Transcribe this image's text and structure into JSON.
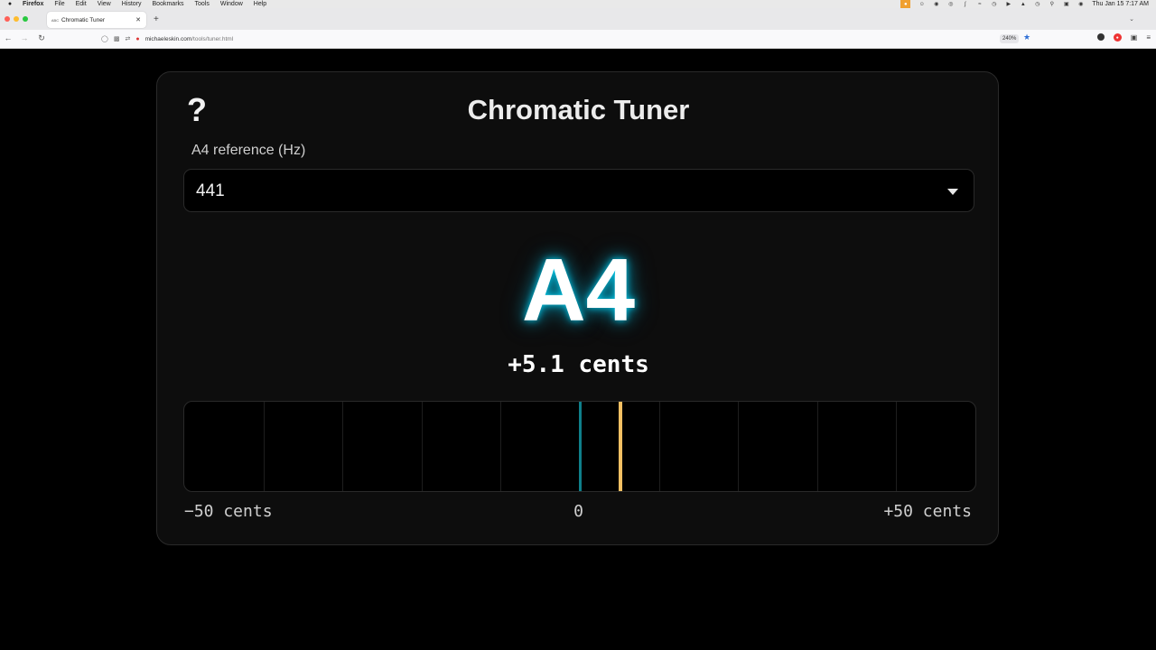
{
  "menubar": {
    "items": [
      "Firefox",
      "File",
      "Edit",
      "View",
      "History",
      "Bookmarks",
      "Tools",
      "Window",
      "Help"
    ],
    "clock": "Thu Jan 15  7:17 AM",
    "status_icons": [
      "mic-recording-icon",
      "person-icon",
      "record-icon",
      "control-icon",
      "bluetooth-icon",
      "wifi-icon",
      "timemachine-icon",
      "volume-icon",
      "eject-icon",
      "history-icon",
      "search-icon",
      "control-center-icon",
      "siri-icon"
    ]
  },
  "browser": {
    "tab_title": "Chromatic Tuner",
    "tab_favicon": "ABC",
    "url_host": "michaeleskin.com",
    "url_path": "/tools/tuner.html",
    "zoom": "240%"
  },
  "tuner": {
    "title": "Chromatic Tuner",
    "help_label": "?",
    "reference_label": "A4 reference (Hz)",
    "reference_value": "441",
    "note": "A4",
    "cents_readout": "+5.1 cents",
    "cents_offset": 5.1,
    "scale_min": -50,
    "scale_max": 50,
    "scale_min_label": "−50 cents",
    "scale_center_label": "0",
    "scale_max_label": "+50 cents",
    "colors": {
      "center_line": "#0f7f8a",
      "needle": "#f5c063",
      "note_glow": "#00dcff"
    }
  }
}
